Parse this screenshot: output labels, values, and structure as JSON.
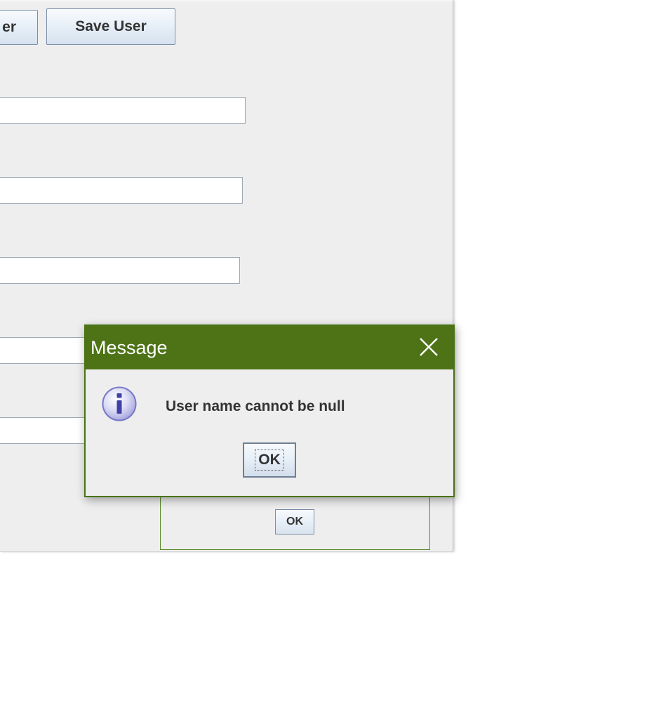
{
  "main_window": {
    "partial_button_label": "er",
    "save_button_label": "Save User",
    "fields": [
      "",
      "",
      "",
      "",
      ""
    ]
  },
  "background_dialog": {
    "ok_label": "OK"
  },
  "dialog": {
    "title": "Message",
    "close_icon": "close-icon",
    "info_icon": "info-icon",
    "message": "User name cannot be null",
    "ok_label": "OK",
    "colors": {
      "titlebar": "#4d7316",
      "body": "#eeeeee"
    }
  }
}
